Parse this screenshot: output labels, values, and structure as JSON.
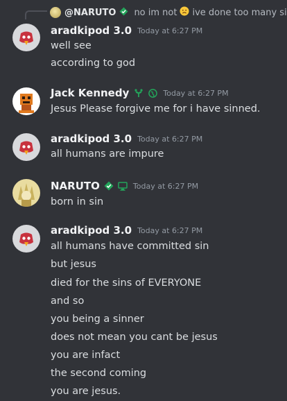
{
  "reply": {
    "author": "@NARUTO",
    "text_before": "no im not",
    "text_after": "ive done too many sins"
  },
  "messages": [
    {
      "author": "aradkipod 3.0",
      "timestamp": "Today at 6:27 PM",
      "lines": [
        "well see",
        "according to god"
      ]
    },
    {
      "author": "Jack Kennedy",
      "timestamp": "Today at 6:27 PM",
      "lines": [
        "Jesus Please forgive me for i have sinned."
      ]
    },
    {
      "author": "aradkipod 3.0",
      "timestamp": "Today at 6:27 PM",
      "lines": [
        "all humans are impure"
      ]
    },
    {
      "author": "NARUTO",
      "timestamp": "Today at 6:27 PM",
      "lines": [
        "born in sin"
      ]
    },
    {
      "author": "aradkipod 3.0",
      "timestamp": "Today at 6:27 PM",
      "lines": [
        "all humans have committed sin",
        "but jesus",
        "died for the sins of EVERYONE",
        "and so",
        "you being a sinner",
        "does not mean you cant be jesus",
        "you are infact",
        "the second coming",
        "you are jesus."
      ]
    }
  ],
  "icons": {
    "reply_avatar": "naruto-avatar",
    "verified_badge": "verified-diamond-icon",
    "sad_emoji": "sad-face-emoji",
    "leaf_badge": "sprout-badge-icon",
    "globe": "globe-icon",
    "desktop": "desktop-icon"
  },
  "colors": {
    "background": "#313338",
    "username": "#f2f3f5",
    "timestamp": "#949ba4",
    "text": "#dbdee1",
    "badge_green": "#23a55a"
  }
}
